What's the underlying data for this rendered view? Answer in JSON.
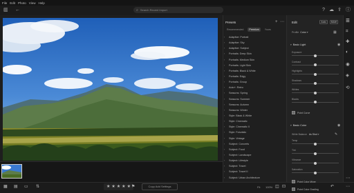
{
  "menu": [
    "File",
    "Edit",
    "Photo",
    "View",
    "Help"
  ],
  "search": {
    "placeholder": "Search Recent Import"
  },
  "presets": {
    "title": "Presets",
    "tabs": [
      "Recommended",
      "Premium",
      "Yours"
    ],
    "active_tab": "Premium",
    "items": [
      "Adaptive: Portrait",
      "Adaptive: Sky",
      "Adaptive: Subject",
      "Portraits: Deep Skin",
      "Portraits: Medium Skin",
      "Portraits: Light Skin",
      "Portraits: Black & White",
      "Portraits: Edgy",
      "Portraits: Group",
      "Auto+: Retro",
      "Seasons: Spring",
      "Seasons: Summer",
      "Seasons: Autumn",
      "Seasons: Winter",
      "Style: Black & White",
      "Style: Cinematic",
      "Style: Cinematic II",
      "Style: Futuristic",
      "Style: Vintage",
      "Subject: Concerts",
      "Subject: Food",
      "Subject: Landscape",
      "Subject: Lifestyle",
      "Subject: Travel",
      "Subject: Travel II",
      "Subject: Urban Architecture"
    ]
  },
  "edit": {
    "title": "Edit",
    "auto_label": "Auto",
    "bw_label": "B&W",
    "profile_label": "Profile",
    "profile_value": "Color",
    "light_section": "Basic Light",
    "light_sliders": [
      {
        "label": "Exposure",
        "value": 0.5
      },
      {
        "label": "Contrast",
        "value": 0.5
      },
      {
        "label": "Highlights",
        "value": 0.5
      },
      {
        "label": "Shadows",
        "value": 0.5
      },
      {
        "label": "Whites",
        "value": 0.5
      },
      {
        "label": "Blacks",
        "value": 0.5
      }
    ],
    "point_curve_label": "Point Curve",
    "color_section": "Basic Color",
    "white_balance_label": "White Balance",
    "white_balance_value": "As Shot",
    "color_sliders": [
      {
        "label": "Temp",
        "value": 0.5
      },
      {
        "label": "Tint",
        "value": 0.5
      },
      {
        "label": "Vibrance",
        "value": 0.5
      },
      {
        "label": "Saturation",
        "value": 0.5
      }
    ],
    "color_mixer_label": "Point Color Mixer",
    "color_grading_label": "Point Color Grading"
  },
  "bottom": {
    "copy_label": "Copy Add Settings",
    "zoom_value": "Fit",
    "zoom_pct": "100%"
  },
  "colors": {
    "background": "#1e1e1e",
    "panel": "#232323",
    "accent": "#ffffff"
  }
}
